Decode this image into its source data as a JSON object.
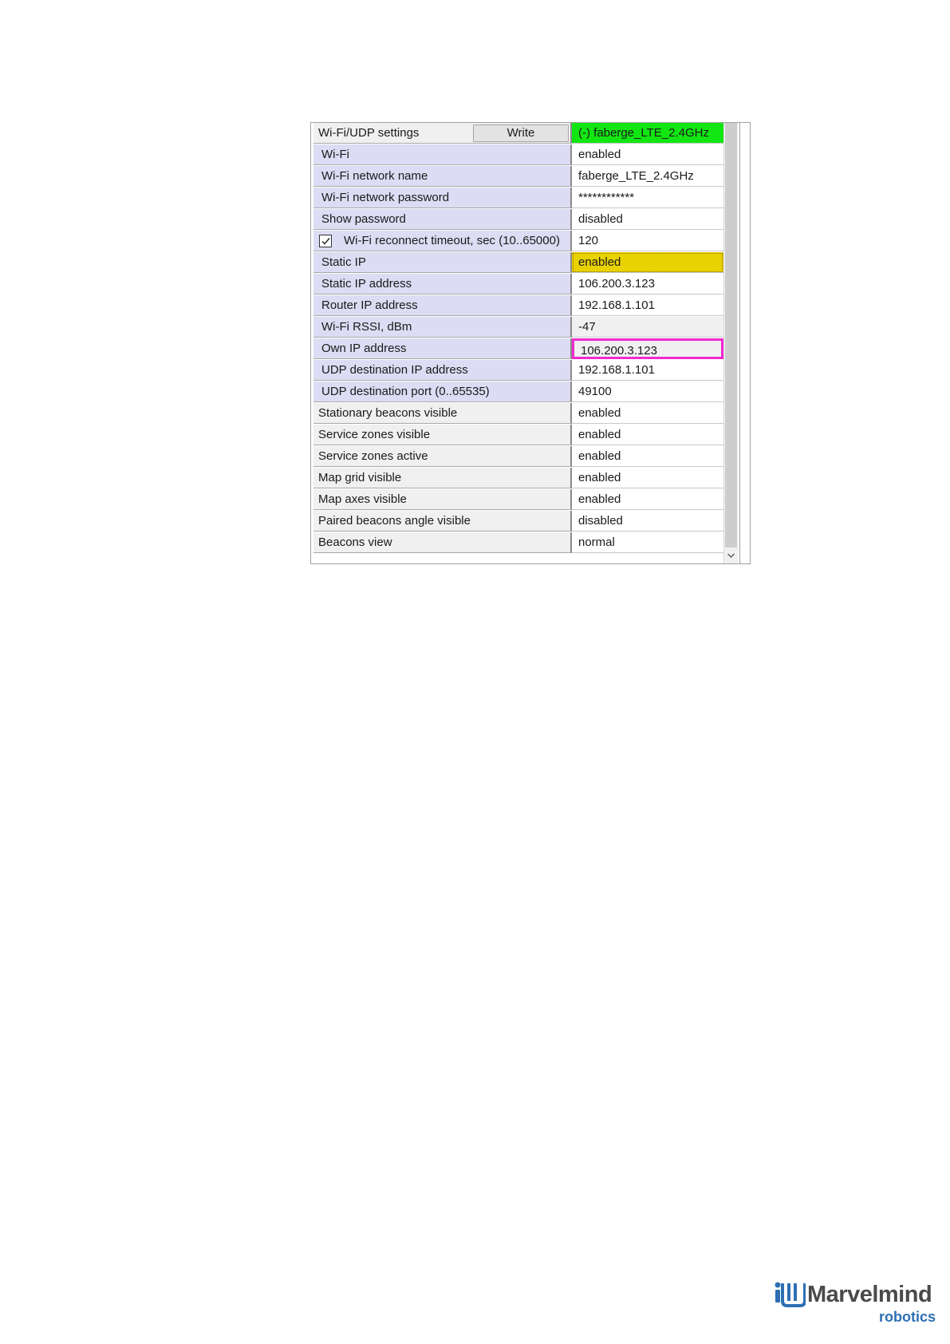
{
  "header": {
    "title": "Wi-Fi/UDP settings",
    "write_label": "Write",
    "network_status": "(-) faberge_LTE_2.4GHz"
  },
  "rows": [
    {
      "label": "Wi-Fi",
      "value": "enabled"
    },
    {
      "label": "Wi-Fi network name",
      "value": "faberge_LTE_2.4GHz"
    },
    {
      "label": "Wi-Fi network password",
      "value": "************"
    },
    {
      "label": "Show password",
      "value": "disabled"
    },
    {
      "label": "Wi-Fi reconnect timeout, sec (10..65000)",
      "value": "120",
      "checked": true
    },
    {
      "label": "Static IP",
      "value": "enabled"
    },
    {
      "label": "Static IP address",
      "value": "106.200.3.123"
    },
    {
      "label": "Router IP address",
      "value": "192.168.1.101"
    },
    {
      "label": "Wi-Fi RSSI, dBm",
      "value": "-47"
    },
    {
      "label": "Own IP address",
      "value": "106.200.3.123"
    },
    {
      "label": "UDP destination IP address",
      "value": "192.168.1.101"
    },
    {
      "label": "UDP destination port (0..65535)",
      "value": "49100"
    },
    {
      "label": "Stationary beacons visible",
      "value": "enabled"
    },
    {
      "label": "Service zones visible",
      "value": "enabled"
    },
    {
      "label": "Service zones active",
      "value": "enabled"
    },
    {
      "label": "Map grid visible",
      "value": "enabled"
    },
    {
      "label": "Map axes visible",
      "value": "enabled"
    },
    {
      "label": "Paired beacons angle visible",
      "value": "disabled"
    },
    {
      "label": "Beacons view",
      "value": "normal"
    }
  ],
  "colors": {
    "status_green": "#12e612",
    "static_ip_yellow": "#e8d200",
    "highlight_magenta": "#f02ad0",
    "subitem_lavender": "#dcdcf4"
  },
  "icons": {
    "checkbox": "checkbox-checked-icon",
    "scroll": "chevron-down-icon"
  },
  "logo": {
    "name": "Marvelmind",
    "sub": "robotics"
  }
}
